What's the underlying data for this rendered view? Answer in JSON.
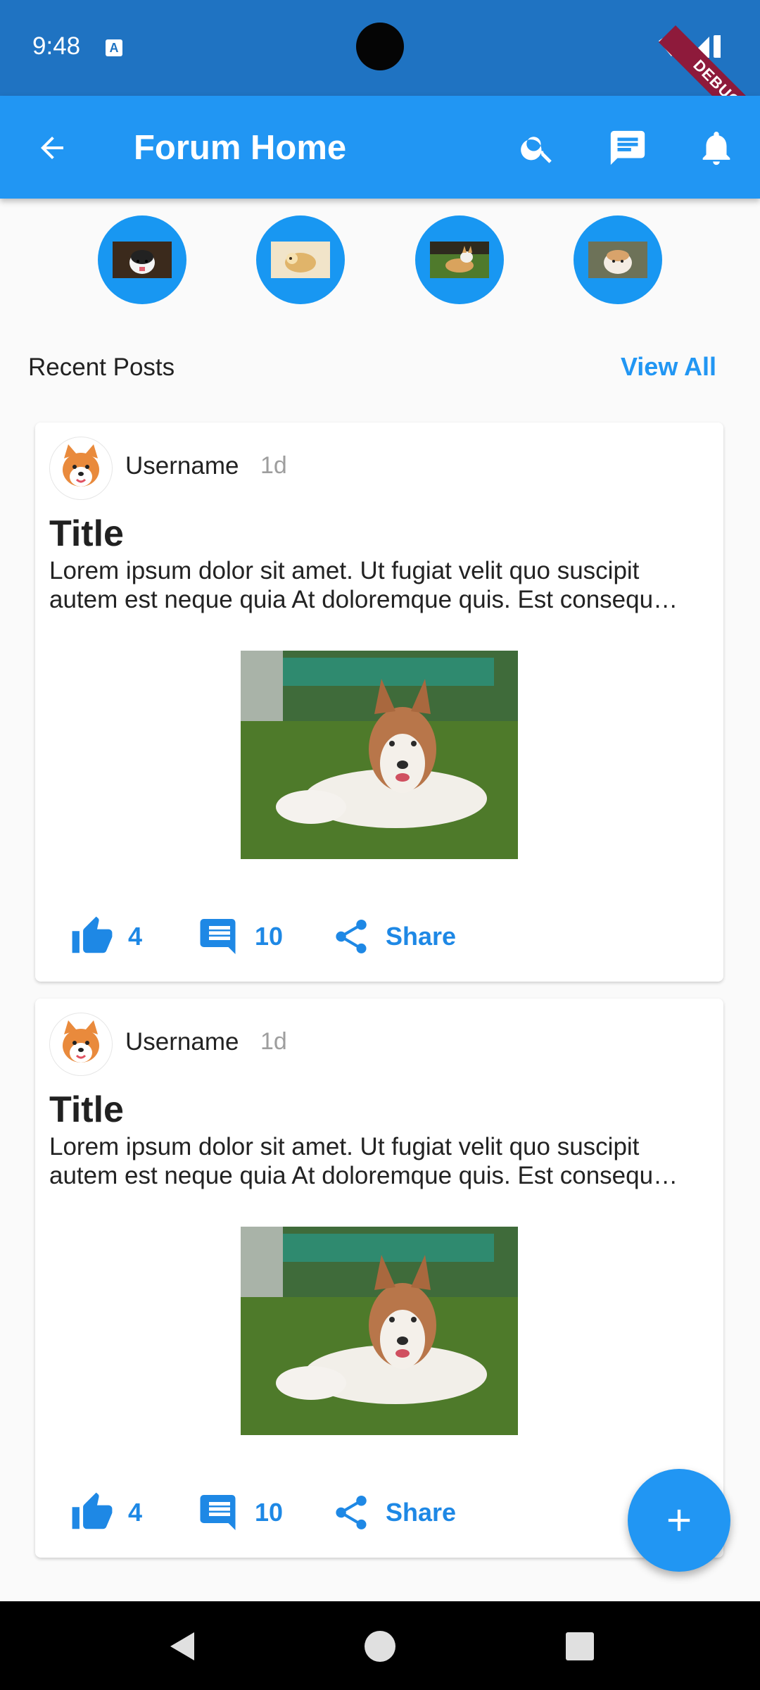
{
  "status_bar": {
    "time": "9:48",
    "notification_icon": "a-icon"
  },
  "debug_banner": {
    "label": "DEBUG"
  },
  "app_bar": {
    "title": "Forum Home",
    "actions": [
      "back-arrow-icon",
      "search-icon",
      "message-icon",
      "bell-icon"
    ]
  },
  "stories": [
    {
      "name": "husky-story",
      "icon": "avatar"
    },
    {
      "name": "shiba-story",
      "icon": "avatar"
    },
    {
      "name": "corgi-story",
      "icon": "avatar"
    },
    {
      "name": "akita-story",
      "icon": "avatar"
    }
  ],
  "section": {
    "title": "Recent Posts",
    "view_all": "View All"
  },
  "posts": [
    {
      "username": "Username",
      "time": "1d",
      "title": "Title",
      "body": "Lorem ipsum dolor sit amet. Ut fugiat velit quo suscipit autem est neque quia At doloremque quis. Est consequ…",
      "likes": "4",
      "comments": "10",
      "share": "Share"
    },
    {
      "username": "Username",
      "time": "1d",
      "title": "Title",
      "body": "Lorem ipsum dolor sit amet. Ut fugiat velit quo suscipit autem est neque quia At doloremque quis. Est consequ…",
      "likes": "4",
      "comments": "10",
      "share": "Share"
    }
  ],
  "fab": {
    "icon": "plus-icon"
  },
  "colors": {
    "primary": "#2196f3",
    "status_bar": "#1f73c2",
    "accent_text": "#1e88e5",
    "debug": "#8e1a3b"
  }
}
